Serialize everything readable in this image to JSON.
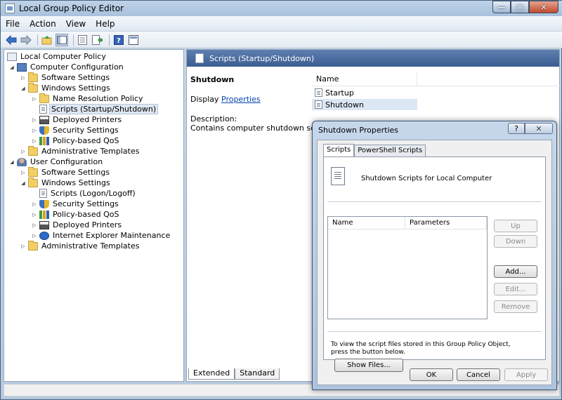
{
  "window": {
    "title": "Local Group Policy Editor",
    "controls": {
      "minimize": "—",
      "maximize": "□",
      "close": "✕"
    }
  },
  "menu": [
    "File",
    "Action",
    "View",
    "Help"
  ],
  "toolbar": {
    "icons": [
      "back-arrow-icon",
      "forward-arrow-icon",
      "up-folder-icon",
      "show-hide-tree-icon",
      "properties-icon",
      "export-list-icon",
      "help-icon",
      "extended-view-icon"
    ]
  },
  "tree": {
    "items": [
      {
        "label": "Local Computer Policy",
        "icon": "policy",
        "expander": ""
      },
      {
        "label": "Computer Configuration",
        "icon": "computer",
        "expander": "◢"
      },
      {
        "label": "Software Settings",
        "icon": "folder",
        "expander": "▷"
      },
      {
        "label": "Windows Settings",
        "icon": "folder",
        "expander": "◢"
      },
      {
        "label": "Name Resolution Policy",
        "icon": "folder",
        "expander": "▷"
      },
      {
        "label": "Scripts (Startup/Shutdown)",
        "icon": "doc",
        "expander": ""
      },
      {
        "label": "Deployed Printers",
        "icon": "printer",
        "expander": "▷"
      },
      {
        "label": "Security Settings",
        "icon": "shield",
        "expander": "▷"
      },
      {
        "label": "Policy-based QoS",
        "icon": "chart",
        "expander": "▷"
      },
      {
        "label": "Administrative Templates",
        "icon": "folder",
        "expander": "▷"
      },
      {
        "label": "User Configuration",
        "icon": "user",
        "expander": "◢"
      },
      {
        "label": "Software Settings",
        "icon": "folder",
        "expander": "▷"
      },
      {
        "label": "Windows Settings",
        "icon": "folder",
        "expander": "◢"
      },
      {
        "label": "Scripts (Logon/Logoff)",
        "icon": "doc",
        "expander": ""
      },
      {
        "label": "Security Settings",
        "icon": "shield",
        "expander": "▷"
      },
      {
        "label": "Policy-based QoS",
        "icon": "chart",
        "expander": "▷"
      },
      {
        "label": "Deployed Printers",
        "icon": "printer",
        "expander": "▷"
      },
      {
        "label": "Internet Explorer Maintenance",
        "icon": "ie",
        "expander": "▷"
      },
      {
        "label": "Administrative Templates",
        "icon": "folder",
        "expander": "▷"
      }
    ],
    "selected_index": 5
  },
  "right_pane": {
    "header": "Scripts (Startup/Shutdown)",
    "item_title": "Shutdown",
    "display_prefix": "Display",
    "display_link": "Properties",
    "description_label": "Description:",
    "description": "Contains computer shutdown scripts.",
    "list_column": "Name",
    "list_items": [
      "Startup",
      "Shutdown"
    ],
    "tabs": [
      "Extended",
      "Standard"
    ]
  },
  "dialog": {
    "title": "Shutdown Properties",
    "help_label": "?",
    "close_label": "✕",
    "tabs": [
      "Scripts",
      "PowerShell Scripts"
    ],
    "heading": "Shutdown Scripts for Local Computer",
    "columns": [
      "Name",
      "Parameters"
    ],
    "side_buttons": {
      "up": "Up",
      "down": "Down",
      "add": "Add...",
      "edit": "Edit...",
      "remove": "Remove"
    },
    "info": "To view the script files stored in this Group Policy Object, press the button below.",
    "show_files": "Show Files...",
    "ok": "OK",
    "cancel": "Cancel",
    "apply": "Apply"
  }
}
